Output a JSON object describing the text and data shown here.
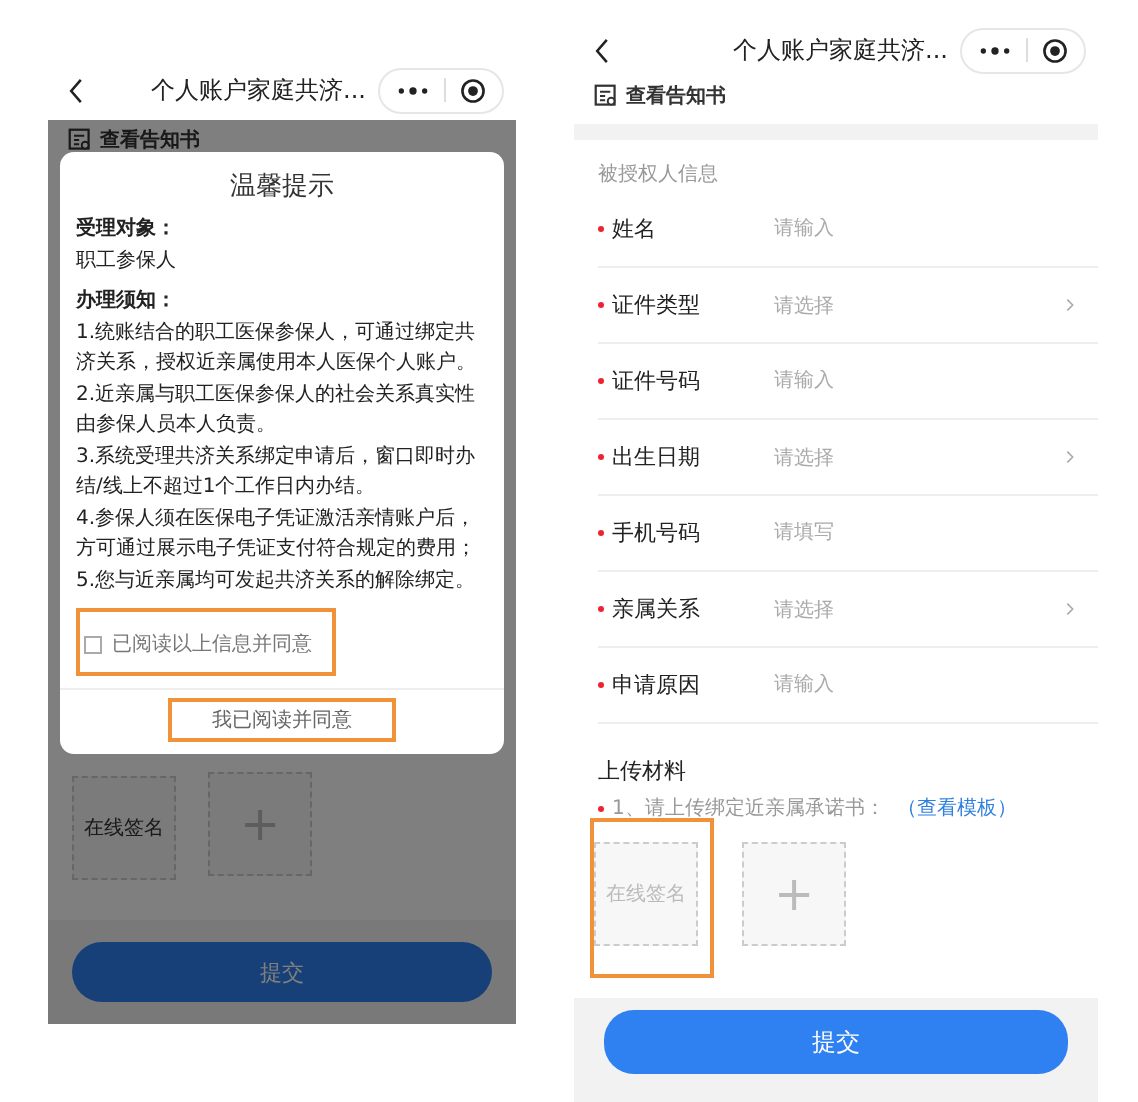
{
  "left_screen": {
    "header": {
      "title": "个人账户家庭共济..."
    },
    "notice_link": "查看告知书",
    "upload_tiles": [
      {
        "kind": "signature",
        "label": "在线签名",
        "highlighted": false
      },
      {
        "kind": "add",
        "label": "+"
      }
    ],
    "submit_button": "提交",
    "dialog": {
      "title": "温馨提示",
      "sections": [
        {
          "heading": "受理对象：",
          "paragraphs": [
            "职工参保人"
          ]
        },
        {
          "heading": "办理须知：",
          "paragraphs": [
            "1.统账结合的职工医保参保人，可通过绑定共济关系，授权近亲属使用本人医保个人账户。",
            "2.近亲属与职工医保参保人的社会关系真实性由参保人员本人负责。",
            "3.系统受理共济关系绑定申请后，窗口即时办结/线上不超过1个工作日内办结。",
            "4.参保人须在医保电子凭证激活亲情账户后，方可通过展示电子凭证支付符合规定的费用；",
            "5.您与近亲属均可发起共济关系的解除绑定。"
          ]
        }
      ],
      "agreement": {
        "label": "已阅读以上信息并同意",
        "checked": false,
        "highlighted": true
      },
      "confirm_button": {
        "label": "我已阅读并同意",
        "highlighted": true
      }
    }
  },
  "right_screen": {
    "header": {
      "title": "个人账户家庭共济..."
    },
    "notice_link": "查看告知书",
    "section_title": "被授权人信息",
    "fields": [
      {
        "label": "姓名",
        "required": true,
        "placeholder": "请输入",
        "kind": "input"
      },
      {
        "label": "证件类型",
        "required": true,
        "placeholder": "请选择",
        "kind": "select"
      },
      {
        "label": "证件号码",
        "required": true,
        "placeholder": "请输入",
        "kind": "input"
      },
      {
        "label": "出生日期",
        "required": true,
        "placeholder": "请选择",
        "kind": "select"
      },
      {
        "label": "手机号码",
        "required": true,
        "placeholder": "请填写",
        "kind": "input"
      },
      {
        "label": "亲属关系",
        "required": true,
        "placeholder": "请选择",
        "kind": "select"
      },
      {
        "label": "申请原因",
        "required": true,
        "placeholder": "请输入",
        "kind": "input"
      }
    ],
    "upload": {
      "title": "上传材料",
      "note": "1、请上传绑定近亲属承诺书：",
      "required": true,
      "link": "（查看模板）",
      "tiles": [
        {
          "kind": "signature",
          "label": "在线签名",
          "highlighted": true
        },
        {
          "kind": "add",
          "label": "+"
        }
      ]
    },
    "submit_button": "提交"
  }
}
